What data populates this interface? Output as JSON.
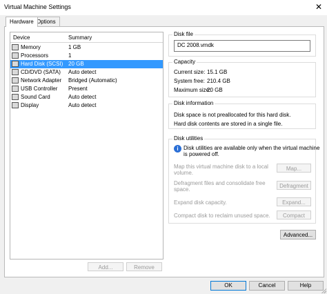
{
  "window": {
    "title": "Virtual Machine Settings",
    "close_glyph": "✕"
  },
  "tabs": [
    {
      "label": "Hardware"
    },
    {
      "label": "Options"
    }
  ],
  "device_list": {
    "headers": {
      "device": "Device",
      "summary": "Summary"
    },
    "rows": [
      {
        "device": "Memory",
        "summary": "1 GB",
        "icon": "memory-icon",
        "selected": false
      },
      {
        "device": "Processors",
        "summary": "1",
        "icon": "processor-icon",
        "selected": false
      },
      {
        "device": "Hard Disk (SCSI)",
        "summary": "20 GB",
        "icon": "hard-disk-icon",
        "selected": true
      },
      {
        "device": "CD/DVD (SATA)",
        "summary": "Auto detect",
        "icon": "cd-dvd-icon",
        "selected": false
      },
      {
        "device": "Network Adapter",
        "summary": "Bridged (Automatic)",
        "icon": "network-adapter-icon",
        "selected": false
      },
      {
        "device": "USB Controller",
        "summary": "Present",
        "icon": "usb-icon",
        "selected": false
      },
      {
        "device": "Sound Card",
        "summary": "Auto detect",
        "icon": "sound-card-icon",
        "selected": false
      },
      {
        "device": "Display",
        "summary": "Auto detect",
        "icon": "display-icon",
        "selected": false
      }
    ]
  },
  "list_buttons": {
    "add": "Add...",
    "remove": "Remove"
  },
  "disk_file": {
    "title": "Disk file",
    "value": "DC 2008.vmdk"
  },
  "capacity": {
    "title": "Capacity",
    "current_label": "Current size:",
    "current_value": "15.1 GB",
    "free_label": "System free:",
    "free_value": "210.4 GB",
    "max_label": "Maximum size:",
    "max_value": "20 GB"
  },
  "disk_information": {
    "title": "Disk information",
    "line1": "Disk space is not preallocated for this hard disk.",
    "line2": "Hard disk contents are stored in a single file."
  },
  "disk_utilities": {
    "title": "Disk utilities",
    "notice_line1": "Disk utilities are available only when the virtual machine",
    "notice_line2": "is powered off.",
    "map_line1": "Map this virtual machine disk to a local",
    "map_line2": "volume.",
    "map_button": "Map...",
    "defrag_line1": "Defragment files and consolidate free",
    "defrag_line2": "space.",
    "defrag_button": "Defragment",
    "expand_text": "Expand disk capacity.",
    "expand_button": "Expand...",
    "compact_text": "Compact disk to reclaim unused space.",
    "compact_button": "Compact"
  },
  "advanced_button": "Advanced...",
  "footer": {
    "ok": "OK",
    "cancel": "Cancel",
    "help": "Help"
  },
  "colors": {
    "selection": "#3399ff",
    "info": "#2b6fd6"
  }
}
